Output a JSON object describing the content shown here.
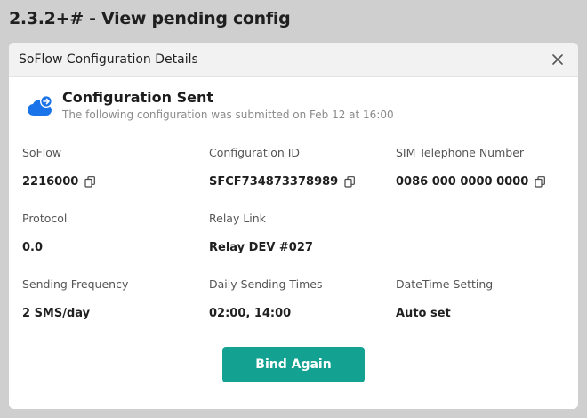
{
  "page": {
    "heading": "2.3.2+# - View pending config"
  },
  "modal": {
    "title": "SoFlow Configuration Details",
    "close_icon": "close-icon",
    "banner": {
      "icon": "cloud-upload-icon",
      "title": "Configuration Sent",
      "subtitle": "The following configuration was submitted on Feb 12 at 16:00"
    },
    "fields": {
      "soflow": {
        "label": "SoFlow",
        "value": "2216000"
      },
      "config_id": {
        "label": "Configuration ID",
        "value": "SFCF734873378989"
      },
      "sim": {
        "label": "SIM Telephone Number",
        "value": "0086 000 0000 0000"
      },
      "protocol": {
        "label": "Protocol",
        "value": "0.0"
      },
      "relay": {
        "label": "Relay Link",
        "value": "Relay DEV #027"
      },
      "frequency": {
        "label": "Sending Frequency",
        "value": "2 SMS/day"
      },
      "times": {
        "label": "Daily Sending Times",
        "value": "02:00, 14:00"
      },
      "datetime": {
        "label": "DateTime Setting",
        "value": "Auto set"
      }
    },
    "bind_button_label": "Bind Again"
  },
  "colors": {
    "accent": "#13a291",
    "icon_blue": "#1a73e8",
    "background": "#cfcfcf"
  }
}
